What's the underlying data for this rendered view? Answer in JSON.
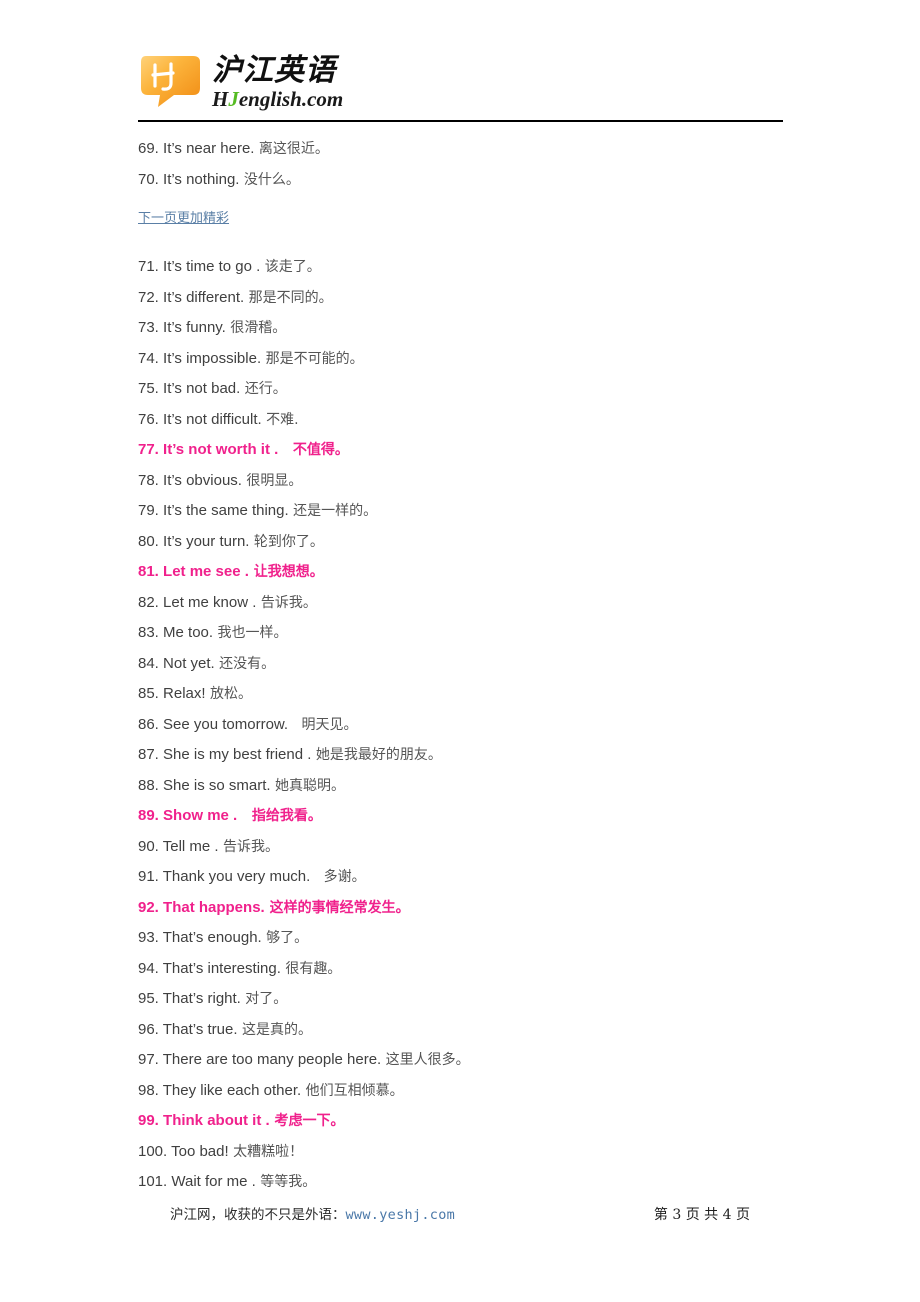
{
  "colors": {
    "highlight_pink": "#f0218c",
    "link_blue": "#5a7fa6",
    "url_blue": "#4a78a8",
    "logo_orange": "#f7a022",
    "logo_green": "#55bb22",
    "body_text": "#404040"
  },
  "header": {
    "logo": {
      "mark_letters": "HJ",
      "chinese_name": "沪江英语",
      "domain_prefix": "H",
      "domain_green": "J",
      "domain_suffix": "english.com"
    }
  },
  "content": {
    "next_page_link": "下一页更加精彩",
    "lines": [
      {
        "num": "69.",
        "en": " It’s near here.",
        "cn": " 离这很近。",
        "highlight": false
      },
      {
        "num": "70.",
        "en": " It’s nothing.",
        "cn": " 没什么。",
        "highlight": false
      },
      {
        "num": "71.",
        "en": " It’s time to go .",
        "cn": " 该走了。",
        "highlight": false
      },
      {
        "num": "72.",
        "en": " It’s different.",
        "cn": " 那是不同的。",
        "highlight": false
      },
      {
        "num": "73.",
        "en": " It’s funny.",
        "cn": " 很滑稽。",
        "highlight": false
      },
      {
        "num": "74.",
        "en": " It’s impossible.",
        "cn": " 那是不可能的。",
        "highlight": false
      },
      {
        "num": "75.",
        "en": " It’s not bad.",
        "cn": " 还行。",
        "highlight": false
      },
      {
        "num": "76.",
        "en": " It’s not difficult.",
        "cn": " 不难.",
        "highlight": false
      },
      {
        "num": "77.",
        "en": " It’s not worth it .",
        "cn": "   不值得。",
        "highlight": true
      },
      {
        "num": "78.",
        "en": " It’s obvious.",
        "cn": " 很明显。",
        "highlight": false
      },
      {
        "num": "79.",
        "en": " It’s the same thing.",
        "cn": " 还是一样的。",
        "highlight": false
      },
      {
        "num": "80.",
        "en": " It’s your turn.",
        "cn": " 轮到你了。",
        "highlight": false
      },
      {
        "num": "81.",
        "en": " Let me see .",
        "cn": " 让我想想。",
        "highlight": true
      },
      {
        "num": "82.",
        "en": " Let me know .",
        "cn": " 告诉我。",
        "highlight": false
      },
      {
        "num": "83.",
        "en": " Me too.",
        "cn": " 我也一样。",
        "highlight": false
      },
      {
        "num": "84.",
        "en": " Not yet.",
        "cn": " 还没有。",
        "highlight": false
      },
      {
        "num": "85.",
        "en": " Relax!",
        "cn": " 放松。",
        "highlight": false
      },
      {
        "num": "86.",
        "en": " See you tomorrow.",
        "cn": "   明天见。",
        "highlight": false
      },
      {
        "num": "87.",
        "en": " She is my best friend .",
        "cn": " 她是我最好的朋友。",
        "highlight": false
      },
      {
        "num": "88.",
        "en": " She is so smart.",
        "cn": " 她真聪明。",
        "highlight": false
      },
      {
        "num": "89.",
        "en": " Show me .",
        "cn": "   指给我看。",
        "highlight": true
      },
      {
        "num": "90.",
        "en": " Tell me .",
        "cn": " 告诉我。",
        "highlight": false
      },
      {
        "num": "91.",
        "en": " Thank you very much.",
        "cn": "   多谢。",
        "highlight": false
      },
      {
        "num": "92.",
        "en": " That happens.",
        "cn": " 这样的事情经常发生。",
        "highlight": true
      },
      {
        "num": "93.",
        "en": " That’s enough.",
        "cn": " 够了。",
        "highlight": false
      },
      {
        "num": "94.",
        "en": " That’s interesting.",
        "cn": " 很有趣。",
        "highlight": false
      },
      {
        "num": "95.",
        "en": " That’s right.",
        "cn": " 对了。",
        "highlight": false
      },
      {
        "num": "96.",
        "en": " That’s true.",
        "cn": " 这是真的。",
        "highlight": false
      },
      {
        "num": "97.",
        "en": " There are too many people here.",
        "cn": " 这里人很多。",
        "highlight": false
      },
      {
        "num": "98.",
        "en": " They like each other.",
        "cn": " 他们互相倾慕。",
        "highlight": false
      },
      {
        "num": "99.",
        "en": " Think about it .",
        "cn": " 考虑一下。",
        "highlight": true
      },
      {
        "num": "100.",
        "en": " Too bad!",
        "cn": " 太糟糕啦！",
        "highlight": false
      },
      {
        "num": "101.",
        "en": " Wait for me .",
        "cn": " 等等我。",
        "highlight": false
      }
    ]
  },
  "footer": {
    "tagline": "沪江网，收获的不只是外语：",
    "url": "www.yeshj.com",
    "page_indicator": "第 3 页 共 4 页"
  }
}
